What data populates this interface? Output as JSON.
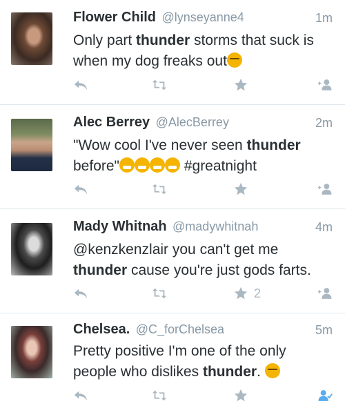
{
  "tweets": [
    {
      "name": "Flower Child",
      "handle": "@lynseyanne4",
      "time": "1m",
      "text": [
        {
          "t": "Only part ",
          "b": false
        },
        {
          "t": "thunder",
          "b": true
        },
        {
          "t": " storms that suck is when my dog freaks out",
          "b": false
        }
      ],
      "emoji": "unamused-face",
      "fav_count": "",
      "follow_state": "follow"
    },
    {
      "name": "Alec Berrey",
      "handle": "@AlecBerrey",
      "time": "2m",
      "text": [
        {
          "t": "\"Wow cool I've never seen ",
          "b": false
        },
        {
          "t": "thunder",
          "b": true
        },
        {
          "t": " before\"",
          "b": false
        }
      ],
      "emoji": "grinning-face x4",
      "hashtag": " #greatnight",
      "fav_count": "",
      "follow_state": "follow"
    },
    {
      "name": "Mady Whitnah",
      "handle": "@madywhitnah",
      "time": "4m",
      "text": [
        {
          "t": "@kenzkenzlair you can't get me ",
          "b": false
        },
        {
          "t": "thunder",
          "b": true
        },
        {
          "t": " cause you're just gods farts.",
          "b": false
        }
      ],
      "fav_count": "2",
      "follow_state": "follow"
    },
    {
      "name": "Chelsea.",
      "handle": "@C_forChelsea",
      "time": "5m",
      "text": [
        {
          "t": "Pretty positive I'm one of the only people who dislikes ",
          "b": false
        },
        {
          "t": "thunder",
          "b": true
        },
        {
          "t": ". ",
          "b": false
        }
      ],
      "emoji": "confounded-face",
      "fav_count": "",
      "follow_state": "following"
    }
  ],
  "icons": {
    "reply": "reply-icon",
    "retweet": "retweet-icon",
    "favorite": "star-icon",
    "follow": "follow-user-icon",
    "following": "following-user-icon"
  },
  "colors": {
    "icon": "#aab8c2",
    "following": "#55acee",
    "handle": "#8899a6"
  }
}
